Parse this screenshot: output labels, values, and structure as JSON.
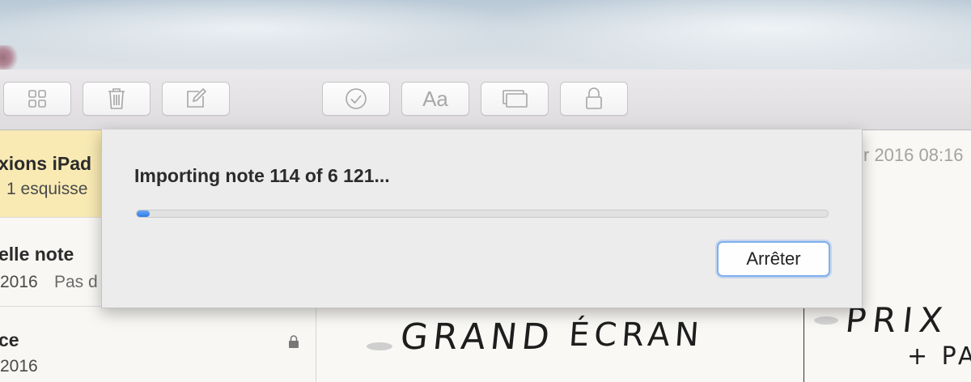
{
  "toolbar": {
    "buttons": [
      {
        "icon": "grid-icon"
      },
      {
        "icon": "trash-icon"
      },
      {
        "icon": "compose-icon"
      },
      {
        "icon": "checkmark-circle-icon"
      },
      {
        "icon": "font-icon",
        "label": "Aa"
      },
      {
        "icon": "gallery-icon"
      },
      {
        "icon": "lock-icon"
      }
    ]
  },
  "notes": [
    {
      "title": "xions iPad",
      "line2": "1 esquisse",
      "selected": true
    },
    {
      "title": "elle note",
      "date": "2016",
      "preview": "Pas d"
    },
    {
      "title": "ce",
      "date": "2016",
      "locked": true
    }
  ],
  "note_view": {
    "date_fragment": "r 2016 08:16",
    "handwriting": [
      "GRAND",
      "ÉCRAN",
      "PRIX",
      "+ PA"
    ]
  },
  "dialog": {
    "message": "Importing note 114 of 6 121...",
    "progress_current": 114,
    "progress_total": 6121,
    "stop_label": "Arrêter"
  },
  "colors": {
    "selected_note": "#f9eab4",
    "accent": "#2d7ae5"
  }
}
